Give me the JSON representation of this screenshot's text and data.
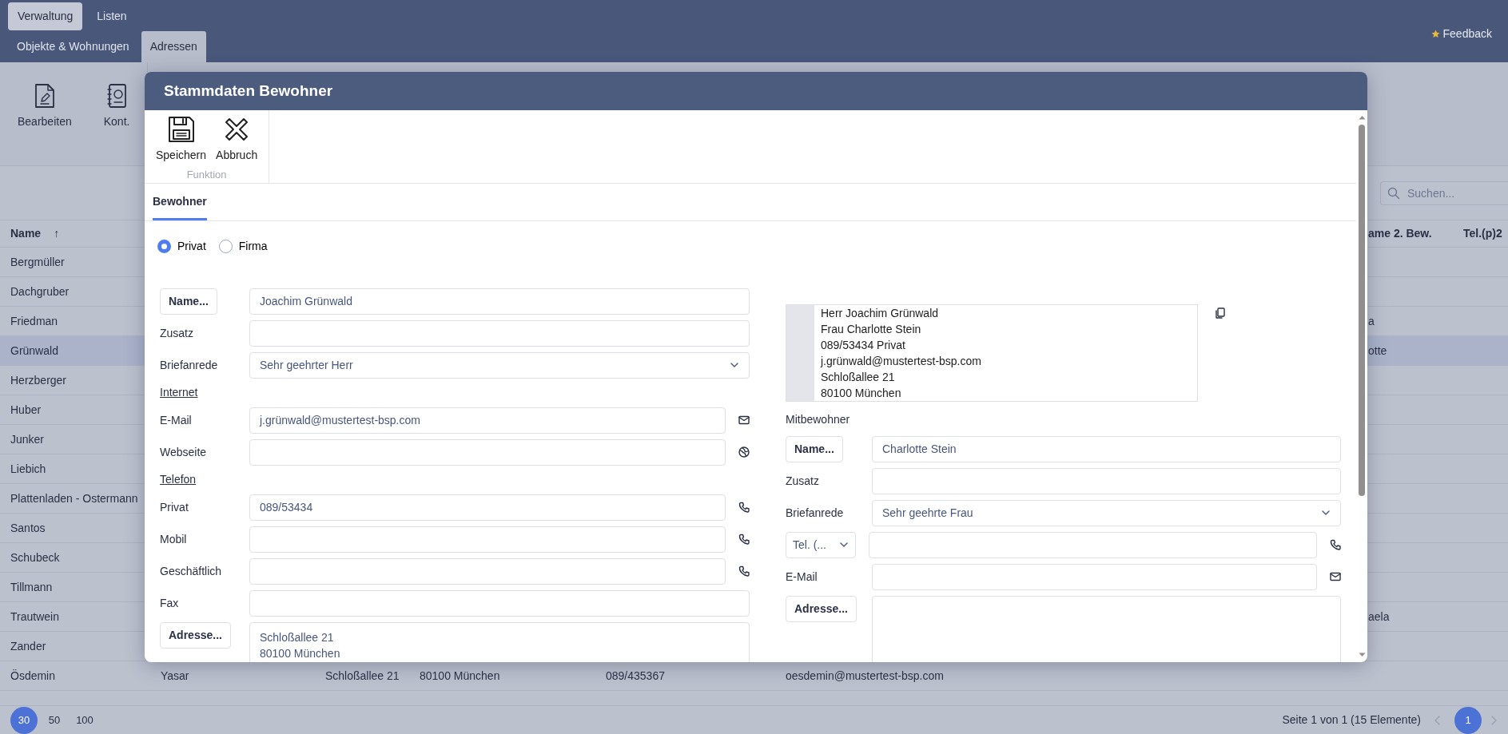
{
  "top_nav": {
    "menus": [
      {
        "label": "Verwaltung",
        "selected": true
      },
      {
        "label": "Listen",
        "selected": false
      }
    ],
    "tabs": [
      {
        "label": "Objekte & Wohnungen",
        "selected": false
      },
      {
        "label": "Adressen",
        "selected": true
      }
    ],
    "feedback": "Feedback"
  },
  "ribbon": {
    "buttons": [
      {
        "label": "Bearbeiten",
        "kind": "edit"
      },
      {
        "label": "Kont.",
        "kind": "contacts"
      }
    ]
  },
  "search": {
    "placeholder": "Suchen..."
  },
  "table": {
    "columns": {
      "name": {
        "label": "Name",
        "sort": "↑"
      },
      "column_7": {
        "label": "ame 2. Bew."
      },
      "column_8": {
        "label": "Tel.(p)2"
      }
    },
    "rows": [
      {
        "name": "Bergmüller",
        "selected": false
      },
      {
        "name": "Dachgruber",
        "selected": false
      },
      {
        "name": "Friedman",
        "column_7": "a",
        "selected": false
      },
      {
        "name": "Grünwald",
        "column_7": "otte",
        "selected": true
      },
      {
        "name": "Herzberger",
        "selected": false
      },
      {
        "name": "Huber",
        "selected": false
      },
      {
        "name": "Junker",
        "selected": false
      },
      {
        "name": "Liebich",
        "selected": false
      },
      {
        "name": "Plattenladen - Ostermann",
        "selected": false
      },
      {
        "name": "Santos",
        "selected": false
      },
      {
        "name": "Schubeck",
        "selected": false
      },
      {
        "name": "Tillmann",
        "selected": false
      },
      {
        "name": "Trautwein",
        "column_7": "aela",
        "selected": false
      },
      {
        "name": "Zander",
        "selected": false
      },
      {
        "name": "Ösdemin",
        "column_2": "Yasar",
        "column_3": "Schloßallee 21",
        "column_4": "80100 München",
        "column_5": "089/435367",
        "column_6": "oesdemin@mustertest-bsp.com",
        "selected": false
      }
    ]
  },
  "pagination": {
    "page_sizes": [
      {
        "label": "30",
        "selected": true
      },
      {
        "label": "50",
        "selected": false
      },
      {
        "label": "100",
        "selected": false
      }
    ],
    "summary": "Seite 1 von 1 (15 Elemente)",
    "pages": [
      {
        "label": "1",
        "selected": true
      }
    ]
  },
  "dialog": {
    "title": "Stammdaten Bewohner",
    "toolbar": {
      "buttons": [
        {
          "label": "Speichern",
          "kind": "save"
        },
        {
          "label": "Abbruch",
          "kind": "cancel"
        }
      ],
      "group_label": "Funktion"
    },
    "tabs": [
      {
        "label": "Bewohner",
        "selected": true
      }
    ],
    "type_options": [
      {
        "label": "Privat",
        "selected": true
      },
      {
        "label": "Firma",
        "selected": false
      }
    ],
    "fields": [
      {
        "kind": "name",
        "label": "Name...",
        "value": "Joachim Grünwald"
      },
      {
        "kind": "text",
        "label": "Zusatz"
      },
      {
        "kind": "select",
        "label": "Briefanrede",
        "value": "Sehr geehrter Herr"
      },
      {
        "kind": "section",
        "label": "Internet"
      },
      {
        "kind": "email",
        "label": "E-Mail",
        "value": "j.grünwald@mustertest-bsp.com"
      },
      {
        "kind": "web",
        "label": "Webseite"
      },
      {
        "kind": "section",
        "label": "Telefon"
      },
      {
        "kind": "phone",
        "label": "Privat",
        "value": "089/53434"
      },
      {
        "kind": "phone",
        "label": "Mobil"
      },
      {
        "kind": "phone",
        "label": "Geschäftlich"
      },
      {
        "kind": "text",
        "label": "Fax"
      },
      {
        "kind": "address",
        "label": "Adresse...",
        "lines": [
          "Schloßallee 21",
          "80100 München"
        ]
      }
    ],
    "summary_lines": [
      "Herr Joachim Grünwald",
      "Frau Charlotte Stein",
      "089/53434 Privat",
      "j.grünwald@mustertest-bsp.com",
      "Schloßallee 21",
      "80100 München"
    ],
    "co_resident": {
      "heading": "Mitbewohner",
      "fields": [
        {
          "kind": "name",
          "label": "Name...",
          "value": "Charlotte Stein"
        },
        {
          "kind": "text",
          "label": "Zusatz"
        },
        {
          "kind": "select",
          "label": "Briefanrede",
          "value": "Sehr geehrte Frau"
        },
        {
          "kind": "phone_select",
          "label": "Tel. (..."
        },
        {
          "kind": "email",
          "label": "E-Mail"
        },
        {
          "kind": "address",
          "label": "Adresse..."
        }
      ]
    }
  }
}
